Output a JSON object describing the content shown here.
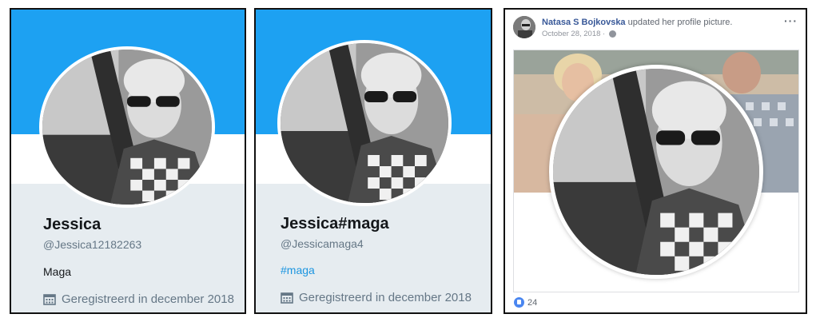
{
  "twitter_profiles": [
    {
      "name": "Jessica",
      "handle": "@Jessica12182263",
      "bio": "Maga",
      "joined": "Geregistreerd in december 2018",
      "joined_icon": "calendar-icon",
      "banner_color": "#1da1f2"
    },
    {
      "name": "Jessica#maga",
      "handle": "@Jessicamaga4",
      "bio": "#maga",
      "joined": "Geregistreerd in december 2018",
      "joined_icon": "calendar-icon",
      "banner_color": "#1da1f2"
    }
  ],
  "facebook_post": {
    "author": "Natasa S Bojkovska",
    "action": " updated her profile picture.",
    "date": "October 28, 2018 ·",
    "privacy_icon": "globe-icon",
    "more_label": "···",
    "reaction_icon": "like-icon",
    "reaction_count": "24",
    "link_color": "#385898"
  }
}
